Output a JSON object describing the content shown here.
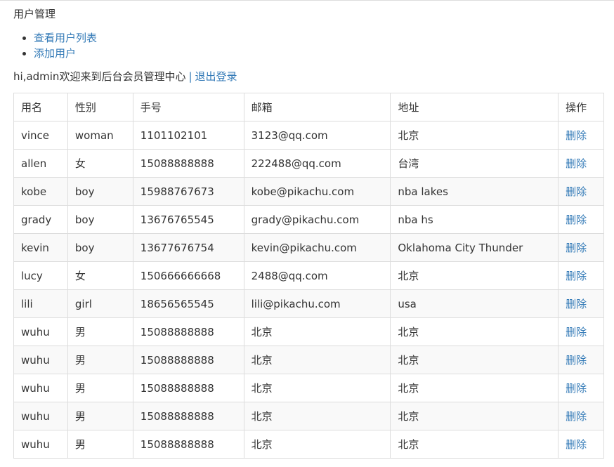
{
  "page": {
    "title": "用户管理"
  },
  "nav": {
    "items": [
      {
        "label": "查看用户列表"
      },
      {
        "label": "添加用户"
      }
    ]
  },
  "welcome": {
    "text": "hi,admin欢迎来到后台会员管理中心",
    "separator": "|",
    "logout_label": "退出登录"
  },
  "table": {
    "headers": [
      "用名",
      "性别",
      "手号",
      "邮箱",
      "地址",
      "操作"
    ],
    "delete_label": "删除",
    "rows": [
      {
        "name": "vince",
        "sex": "woman",
        "phone": "1101102101",
        "email": "3123@qq.com",
        "address": "北京"
      },
      {
        "name": "allen",
        "sex": "女",
        "phone": "15088888888",
        "email": "222488@qq.com",
        "address": "台湾"
      },
      {
        "name": "kobe",
        "sex": "boy",
        "phone": "15988767673",
        "email": "kobe@pikachu.com",
        "address": "nba lakes"
      },
      {
        "name": "grady",
        "sex": "boy",
        "phone": "13676765545",
        "email": "grady@pikachu.com",
        "address": "nba hs"
      },
      {
        "name": "kevin",
        "sex": "boy",
        "phone": "13677676754",
        "email": "kevin@pikachu.com",
        "address": "Oklahoma City Thunder"
      },
      {
        "name": "lucy",
        "sex": "女",
        "phone": "150666666668",
        "email": "2488@qq.com",
        "address": "北京"
      },
      {
        "name": "lili",
        "sex": "girl",
        "phone": "18656565545",
        "email": "lili@pikachu.com",
        "address": "usa"
      },
      {
        "name": "wuhu",
        "sex": "男",
        "phone": "15088888888",
        "email": "北京",
        "address": "北京"
      },
      {
        "name": "wuhu",
        "sex": "男",
        "phone": "15088888888",
        "email": "北京",
        "address": "北京"
      },
      {
        "name": "wuhu",
        "sex": "男",
        "phone": "15088888888",
        "email": "北京",
        "address": "北京"
      },
      {
        "name": "wuhu",
        "sex": "男",
        "phone": "15088888888",
        "email": "北京",
        "address": "北京"
      },
      {
        "name": "wuhu",
        "sex": "男",
        "phone": "15088888888",
        "email": "北京",
        "address": "北京"
      }
    ]
  },
  "colors": {
    "link": "#337ab7",
    "text": "#333333",
    "border": "#dddddd",
    "stripe": "#f9f9f9"
  }
}
